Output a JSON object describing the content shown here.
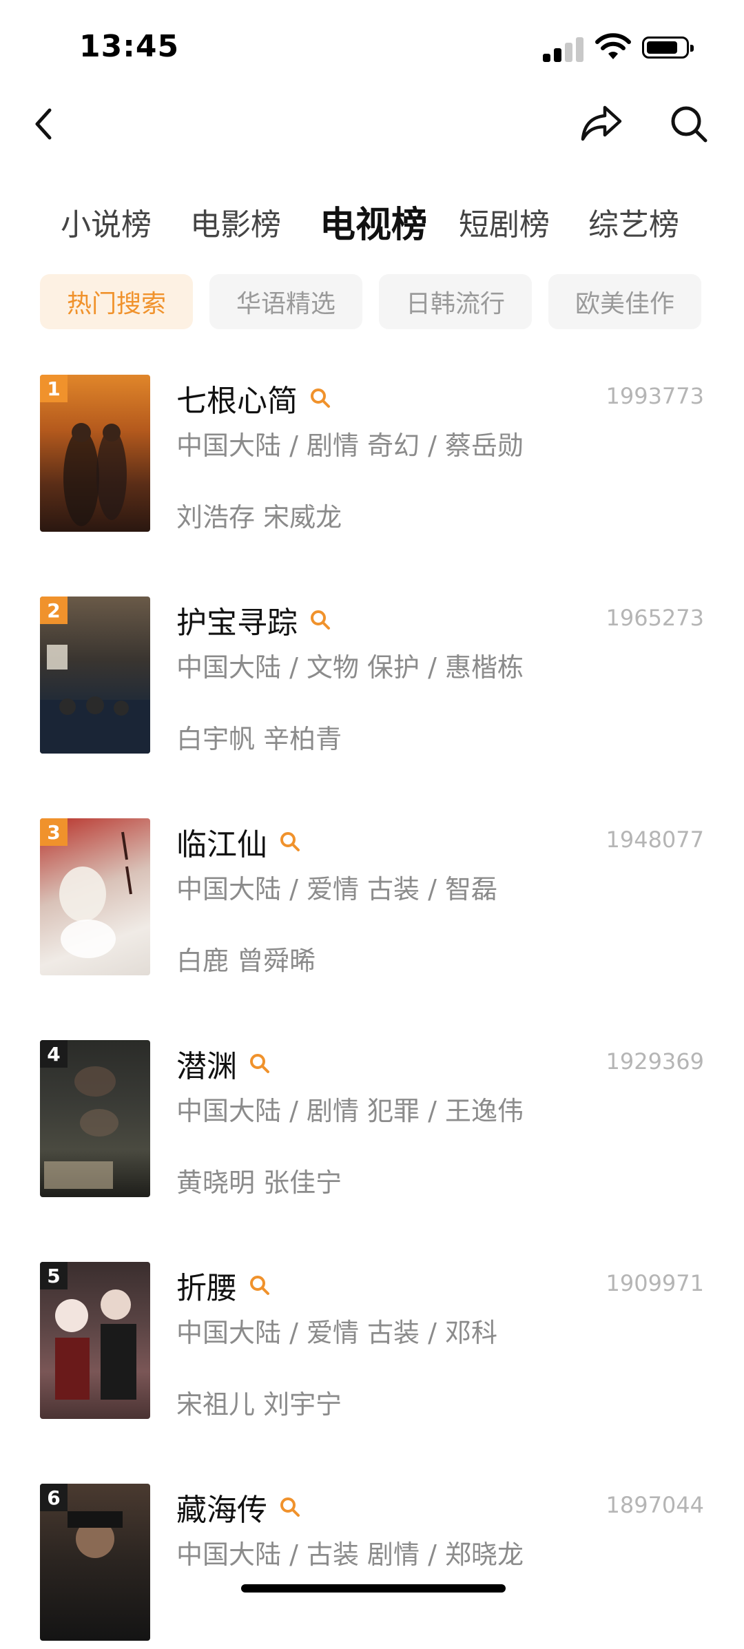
{
  "status_bar": {
    "time": "13:45"
  },
  "tabs": [
    {
      "label": "小说榜",
      "active": false
    },
    {
      "label": "电影榜",
      "active": false
    },
    {
      "label": "电视榜",
      "active": true
    },
    {
      "label": "短剧榜",
      "active": false
    },
    {
      "label": "综艺榜",
      "active": false
    }
  ],
  "chips": [
    {
      "label": "热门搜索",
      "active": true
    },
    {
      "label": "华语精选",
      "active": false
    },
    {
      "label": "日韩流行",
      "active": false
    },
    {
      "label": "欧美佳作",
      "active": false
    }
  ],
  "colors": {
    "accent": "#f0922c",
    "rank_top3": "#f0922c",
    "rank_other": "#1b1b1b"
  },
  "items": [
    {
      "rank": "1",
      "title": "七根心简",
      "count": "1993773",
      "meta": "中国大陆 / 剧情 奇幻 / 蔡岳勋",
      "cast": "刘浩存 宋威龙"
    },
    {
      "rank": "2",
      "title": "护宝寻踪",
      "count": "1965273",
      "meta": "中国大陆 / 文物 保护 / 惠楷栋",
      "cast": "白宇帆 辛柏青"
    },
    {
      "rank": "3",
      "title": "临江仙",
      "count": "1948077",
      "meta": "中国大陆 / 爱情 古装 / 智磊",
      "cast": "白鹿 曾舜晞"
    },
    {
      "rank": "4",
      "title": "潜渊",
      "count": "1929369",
      "meta": "中国大陆 / 剧情 犯罪 / 王逸伟",
      "cast": "黄晓明 张佳宁"
    },
    {
      "rank": "5",
      "title": "折腰",
      "count": "1909971",
      "meta": "中国大陆 / 爱情 古装 / 邓科",
      "cast": "宋祖儿 刘宇宁"
    },
    {
      "rank": "6",
      "title": "藏海传",
      "count": "1897044",
      "meta": "中国大陆 / 古装 剧情 / 郑晓龙",
      "cast": ""
    }
  ]
}
